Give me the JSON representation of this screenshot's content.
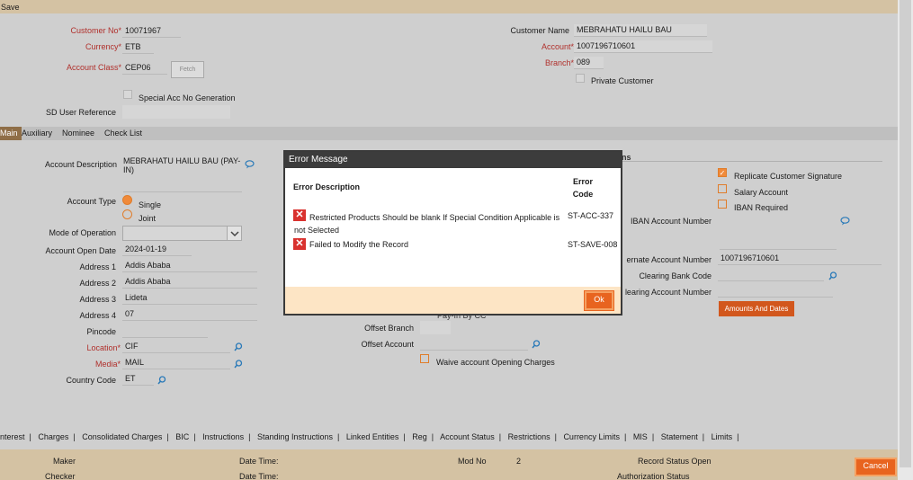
{
  "topbar": {
    "save": "Save"
  },
  "header": {
    "customer_no_label": "Customer No",
    "customer_no": "10071967",
    "currency_label": "Currency",
    "currency": "ETB",
    "account_class_label": "Account Class",
    "account_class": "CEP06",
    "fetch": "Fetch",
    "special_acc_label": "Special Acc No Generation",
    "sd_user_ref_label": "SD User Reference",
    "customer_name_label": "Customer Name",
    "customer_name": "MEBRAHATU HAILU BAU",
    "account_label": "Account",
    "account": "1007196710601",
    "branch_label": "Branch",
    "branch": "089",
    "private_customer_label": "Private Customer",
    "required_mark": "*"
  },
  "tabs": [
    "Main",
    "Auxiliary",
    "Nominee",
    "Check List"
  ],
  "main": {
    "account_description_label": "Account Description",
    "account_description": "MEBRAHATU HAILU BAU (PAY-IN)",
    "account_type_label": "Account Type",
    "single": "Single",
    "joint": "Joint",
    "mode_of_operation_label": "Mode of Operation",
    "account_open_date_label": "Account Open Date",
    "account_open_date": "2024-01-19",
    "address1_label": "Address 1",
    "address1": "Addis Ababa",
    "address2_label": "Address 2",
    "address2": "Addis Ababa",
    "address3_label": "Address 3",
    "address3": "Lideta",
    "address4_label": "Address 4",
    "address4": "07",
    "pincode_label": "Pincode",
    "location_label": "Location",
    "location": "CIF",
    "media_label": "Media",
    "media": "MAIL",
    "country_code_label": "Country Code",
    "country_code": "ET",
    "offset_branch_label": "Offset Branch",
    "offset_account_label": "Offset Account",
    "pay_in_partial": "Pay-In By CC",
    "waive_label": "Waive account Opening Charges",
    "options_heading_partial": "ns",
    "replicate_sig_label": "Replicate Customer Signature",
    "salary_account_label": "Salary Account",
    "iban_required_label": "IBAN Required",
    "iban_account_number_label": "IBAN Account Number",
    "alternate_account_label": "ernate Account Number",
    "alternate_account": "1007196710601",
    "clearing_bank_code_label": "Clearing Bank Code",
    "clearing_account_label": "learing Account Number",
    "amounts_dates_btn": "Amounts And Dates"
  },
  "bottom_tabs": [
    "nterest",
    "Charges",
    "Consolidated Charges",
    "BIC",
    "Instructions",
    "Standing Instructions",
    "Linked Entities",
    "Reg",
    "Account Status",
    "Restrictions",
    "Currency Limits",
    "MIS",
    "Statement",
    "Limits"
  ],
  "footer": {
    "maker": "Maker",
    "checker": "Checker",
    "date_time1": "Date Time:",
    "date_time2": "Date Time:",
    "mod_no_label": "Mod No",
    "mod_no": "2",
    "record_status": "Record Status",
    "record_status_value": "Open",
    "authorization_status": "Authorization Status",
    "cancel": "Cancel"
  },
  "dialog": {
    "title": "Error Message",
    "col_desc": "Error Description",
    "col_code": "Error Code",
    "errors": [
      {
        "desc": "Restricted Products Should be blank If Special Condition Applicable is not Selected",
        "code": "ST-ACC-337"
      },
      {
        "desc": "Failed to Modify the Record",
        "code": "ST-SAVE-008"
      }
    ],
    "ok": "Ok"
  },
  "colors": {
    "accent": "#e8641f",
    "header_band": "#d4c2a3",
    "required": "#b0302c",
    "error": "#d9322f"
  }
}
